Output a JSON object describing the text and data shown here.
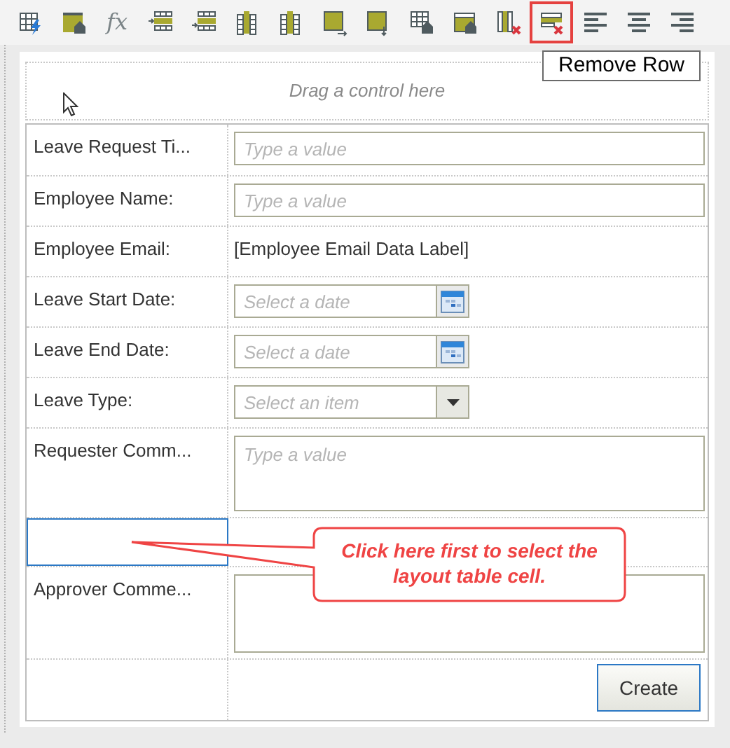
{
  "toolbar": {
    "buttons": [
      {
        "selected": false
      },
      {
        "selected": false
      },
      {
        "selected": false,
        "label": "fx"
      },
      {
        "selected": false
      },
      {
        "selected": false
      },
      {
        "selected": false
      },
      {
        "selected": false
      },
      {
        "selected": false
      },
      {
        "selected": false
      },
      {
        "selected": false
      },
      {
        "selected": false
      },
      {
        "selected": false
      },
      {
        "selected": true
      },
      {
        "selected": false
      },
      {
        "selected": false
      },
      {
        "selected": false
      }
    ],
    "tooltip": "Remove Row"
  },
  "canvas": {
    "drop_zone": "Drag a control here",
    "rows": [
      {
        "label": "Leave Request Ti...",
        "kind": "text",
        "placeholder": "Type a value",
        "selected": false
      },
      {
        "label": "Employee Name:",
        "kind": "text",
        "placeholder": "Type a value",
        "selected": false
      },
      {
        "label": "Employee Email:",
        "kind": "label",
        "value": "[Employee Email Data Label]",
        "selected": false
      },
      {
        "label": "Leave Start Date:",
        "kind": "date",
        "placeholder": "Select a date",
        "selected": false
      },
      {
        "label": "Leave End Date:",
        "kind": "date",
        "placeholder": "Select a date",
        "selected": false
      },
      {
        "label": "Leave Type:",
        "kind": "dropdown",
        "placeholder": "Select an item",
        "selected": false
      },
      {
        "label": "Requester Comm...",
        "kind": "textarea",
        "placeholder": "Type a value",
        "selected": false
      },
      {
        "kind": "blank",
        "selected": true
      },
      {
        "label": "Approver Comme...",
        "kind": "textarea",
        "selected": false
      },
      {
        "kind": "button",
        "button": "Create",
        "selected": false
      }
    ]
  },
  "callout": {
    "text": "Click here first to select the layout table cell."
  }
}
